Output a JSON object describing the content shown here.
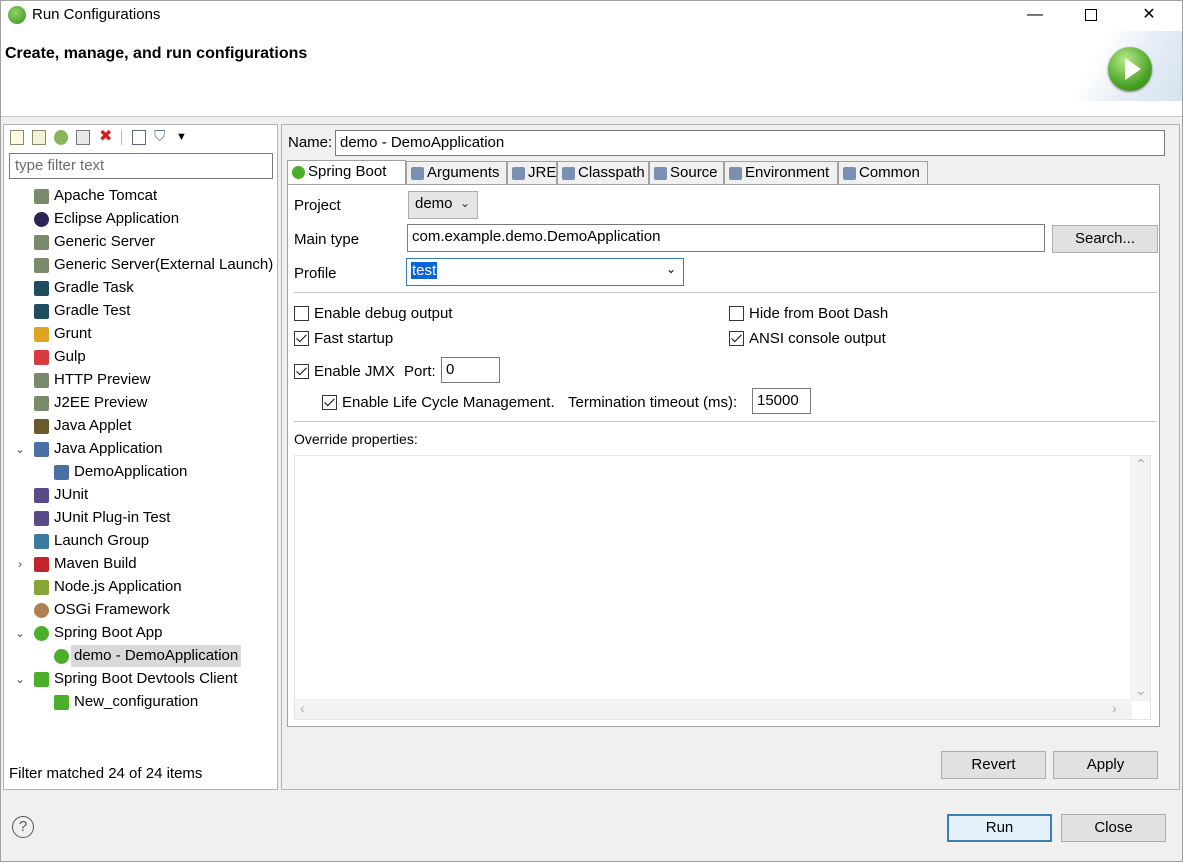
{
  "window": {
    "title": "Run Configurations",
    "minimize": "—",
    "close": "✕"
  },
  "header": {
    "heading": "Create, manage, and run configurations"
  },
  "left": {
    "filter_placeholder": "type filter text",
    "status": "Filter matched 24 of 24 items",
    "tree": [
      {
        "label": "Apache Tomcat",
        "icon": "server-icon",
        "color": "#7a8a6a"
      },
      {
        "label": "Eclipse Application",
        "icon": "eclipse-icon",
        "color": "#2c2255"
      },
      {
        "label": "Generic Server",
        "icon": "server-icon",
        "color": "#7a8a6a"
      },
      {
        "label": "Generic Server(External Launch)",
        "icon": "server-icon",
        "color": "#7a8a6a"
      },
      {
        "label": "Gradle Task",
        "icon": "gradle-icon",
        "color": "#1d4d5e"
      },
      {
        "label": "Gradle Test",
        "icon": "gradle-icon",
        "color": "#1d4d5e"
      },
      {
        "label": "Grunt",
        "icon": "grunt-icon",
        "color": "#e0a420"
      },
      {
        "label": "Gulp",
        "icon": "gulp-icon",
        "color": "#d63c3c"
      },
      {
        "label": "HTTP Preview",
        "icon": "server-icon",
        "color": "#7a8a6a"
      },
      {
        "label": "J2EE Preview",
        "icon": "server-icon",
        "color": "#7a8a6a"
      },
      {
        "label": "Java Applet",
        "icon": "applet-icon",
        "color": "#6a5a2a"
      },
      {
        "label": "Java Application",
        "icon": "java-app-icon",
        "color": "#4a6fa5",
        "expander": "⌄"
      },
      {
        "label": "DemoApplication",
        "icon": "java-app-icon",
        "color": "#4a6fa5",
        "child": true
      },
      {
        "label": "JUnit",
        "icon": "junit-icon",
        "color": "#5a4a8a"
      },
      {
        "label": "JUnit Plug-in Test",
        "icon": "junit-icon",
        "color": "#5a4a8a"
      },
      {
        "label": "Launch Group",
        "icon": "launch-group-icon",
        "color": "#3a7aa0"
      },
      {
        "label": "Maven Build",
        "icon": "maven-icon",
        "color": "#c4252a",
        "expander": "›"
      },
      {
        "label": "Node.js Application",
        "icon": "nodejs-icon",
        "color": "#83a636"
      },
      {
        "label": "OSGi Framework",
        "icon": "osgi-icon",
        "color": "#b08050"
      },
      {
        "label": "Spring Boot App",
        "icon": "spring-icon",
        "color": "#4caf2a",
        "expander": "⌄"
      },
      {
        "label": "demo - DemoApplication",
        "icon": "spring-icon",
        "color": "#4caf2a",
        "child": true,
        "selected": true
      },
      {
        "label": "Spring Boot Devtools Client",
        "icon": "devtools-icon",
        "color": "#4caf2a",
        "expander": "⌄"
      },
      {
        "label": "New_configuration",
        "icon": "devtools-icon",
        "color": "#4caf2a",
        "child": true
      }
    ]
  },
  "right": {
    "name_label": "Name:",
    "name_value": "demo - DemoApplication",
    "tabs": [
      {
        "label": "Spring Boot",
        "icon": "spring-icon",
        "active": true
      },
      {
        "label": "Arguments",
        "icon": "arguments-icon"
      },
      {
        "label": "JRE",
        "icon": "jre-icon"
      },
      {
        "label": "Classpath",
        "icon": "classpath-icon"
      },
      {
        "label": "Source",
        "icon": "source-icon"
      },
      {
        "label": "Environment",
        "icon": "environment-icon"
      },
      {
        "label": "Common",
        "icon": "common-icon"
      }
    ],
    "project_label": "Project",
    "project_value": "demo",
    "main_type_label": "Main type",
    "main_type_value": "com.example.demo.DemoApplication",
    "search_button": "Search...",
    "profile_label": "Profile",
    "profile_value": "test",
    "checkboxes": {
      "debug": {
        "label": "Enable debug output",
        "checked": false
      },
      "fast": {
        "label": "Fast startup",
        "checked": true
      },
      "hide": {
        "label": "Hide from Boot Dash",
        "checked": false
      },
      "ansi": {
        "label": "ANSI console output",
        "checked": true
      },
      "jmx": {
        "label": "Enable JMX",
        "checked": true
      },
      "lifecycle": {
        "label": "Enable Life Cycle Management.",
        "checked": true
      }
    },
    "port_label": "Port:",
    "port_value": "0",
    "timeout_label": "Termination timeout (ms):",
    "timeout_value": "15000",
    "override_label": "Override properties:",
    "revert_button": "Revert",
    "apply_button": "Apply"
  },
  "footer": {
    "help": "?",
    "run_button": "Run",
    "close_button": "Close"
  }
}
